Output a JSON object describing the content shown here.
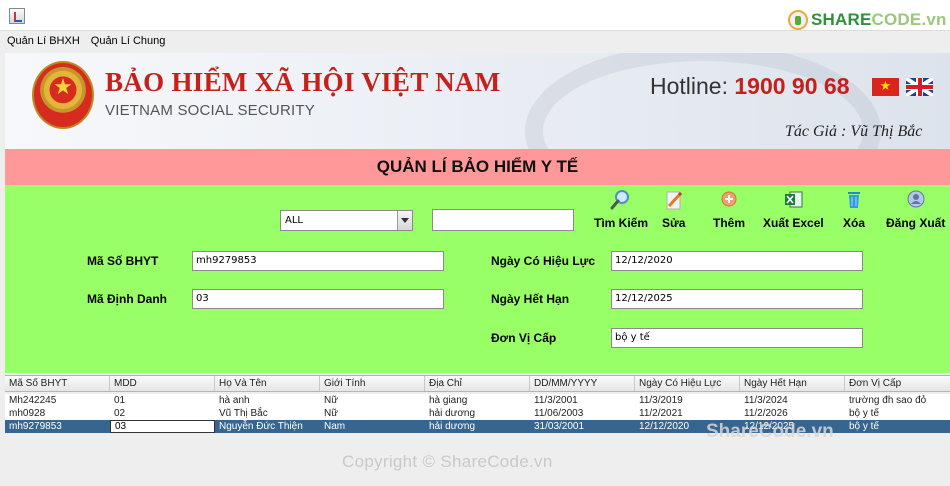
{
  "window": {
    "icon": "java-app-icon"
  },
  "watermark": {
    "logo_main": "SHARE",
    "logo_rest": "CODE.vn",
    "overlay": "ShareCode.vn",
    "copyright": "Copyright © ShareCode.vn"
  },
  "menu": {
    "items": [
      "Quản Lí BHXH",
      "Quản Lí Chung"
    ]
  },
  "banner": {
    "org_name": "BẢO HIỂM XÃ HỘI VIỆT NAM",
    "org_sub": "VIETNAM SOCIAL SECURITY",
    "hotline_label": "Hotline:",
    "hotline_number": "1900 90 68",
    "author": "Tác Giả : Vũ Thị Bắc"
  },
  "heading": "QUẢN LÍ BẢO HIỂM Y TẾ",
  "toolbar": {
    "filter": {
      "selected": "ALL"
    },
    "search_value": "",
    "buttons": [
      {
        "id": "search",
        "label": "Tìm Kiếm",
        "icon": "magnifier-icon"
      },
      {
        "id": "edit",
        "label": "Sửa",
        "icon": "pencil-icon"
      },
      {
        "id": "add",
        "label": "Thêm",
        "icon": "plus-icon"
      },
      {
        "id": "export",
        "label": "Xuất Excel",
        "icon": "excel-icon"
      },
      {
        "id": "delete",
        "label": "Xóa",
        "icon": "trash-icon"
      },
      {
        "id": "logout",
        "label": "Đăng Xuất",
        "icon": "user-icon"
      }
    ]
  },
  "form": {
    "ma_so_bhyt": {
      "label": "Mã Số BHYT",
      "value": "mh9279853"
    },
    "ma_dinh_danh": {
      "label": "Mã Định Danh",
      "value": "03"
    },
    "ngay_co_hieu_luc": {
      "label": "Ngày Có Hiệu Lực",
      "value": "12/12/2020"
    },
    "ngay_het_han": {
      "label": "Ngày Hết Hạn",
      "value": "12/12/2025"
    },
    "don_vi_cap": {
      "label": "Đơn Vị Cấp",
      "value": "bộ y tế"
    }
  },
  "table": {
    "columns": [
      "Mã Số BHYT",
      "MDD",
      "Họ Và Tên",
      "Giới Tính",
      "Địa Chỉ",
      "DD/MM/YYYY",
      "Ngày Có Hiệu Lực",
      "Ngày Hết Hạn",
      "Đơn Vị Cấp"
    ],
    "rows": [
      [
        "Mh242245",
        "01",
        "hà anh",
        "Nữ",
        "hà giang",
        "11/3/2001",
        "11/3/2019",
        "11/3/2024",
        "trường đh sao đỏ"
      ],
      [
        "mh0928",
        "02",
        "Vũ Thị Bắc",
        "Nữ",
        "hải dương",
        "11/06/2003",
        "11/2/2021",
        "11/2/2026",
        "bộ y tế"
      ],
      [
        "mh9279853",
        "03",
        "Nguyễn Đức Thiện",
        "Nam",
        "hải dương",
        "31/03/2001",
        "12/12/2020",
        "12/12/2025",
        "bộ y tế"
      ]
    ],
    "selected_row": 2
  },
  "colors": {
    "form_bg": "#99ff66",
    "heading_bg": "#ff9999",
    "brand_red": "#c3211a",
    "selection": "#36658f"
  }
}
